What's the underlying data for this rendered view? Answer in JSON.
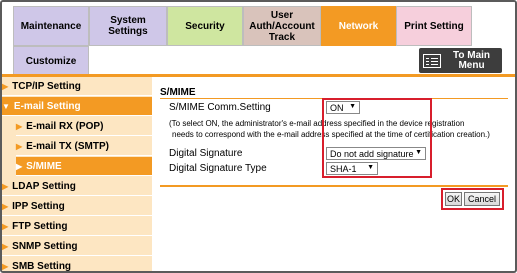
{
  "tabs": {
    "maintenance": "Maintenance",
    "system_settings": "System Settings",
    "security": "Security",
    "user_auth": "User\nAuth/Account\nTrack",
    "network": "Network",
    "print_setting": "Print Setting",
    "customize": "Customize",
    "to_main_menu": "To Main\nMenu"
  },
  "sidebar": {
    "items": [
      {
        "label": "TCP/IP Setting"
      },
      {
        "label": "E-mail Setting"
      },
      {
        "label": "E-mail RX (POP)"
      },
      {
        "label": "E-mail TX (SMTP)"
      },
      {
        "label": "S/MIME"
      },
      {
        "label": "LDAP Setting"
      },
      {
        "label": "IPP Setting"
      },
      {
        "label": "FTP Setting"
      },
      {
        "label": "SNMP Setting"
      },
      {
        "label": "SMB Setting"
      }
    ]
  },
  "main": {
    "section_title": "S/MIME",
    "smime_comm_label": "S/MIME Comm.Setting",
    "smime_comm_value": "ON",
    "note_line1": "(To select ON, the administrator's e-mail address specified in the device registration",
    "note_line2": "needs to correspond with the e-mail address specified at the time of certification creation.)",
    "digital_signature_label": "Digital Signature",
    "digital_signature_value": "Do not add signature",
    "digital_signature_type_label": "Digital Signature Type",
    "digital_signature_type_value": "SHA-1",
    "ok_label": "OK",
    "cancel_label": "Cancel"
  },
  "colors": {
    "accent": "#f39a23",
    "highlight_box": "#d81e2c"
  }
}
